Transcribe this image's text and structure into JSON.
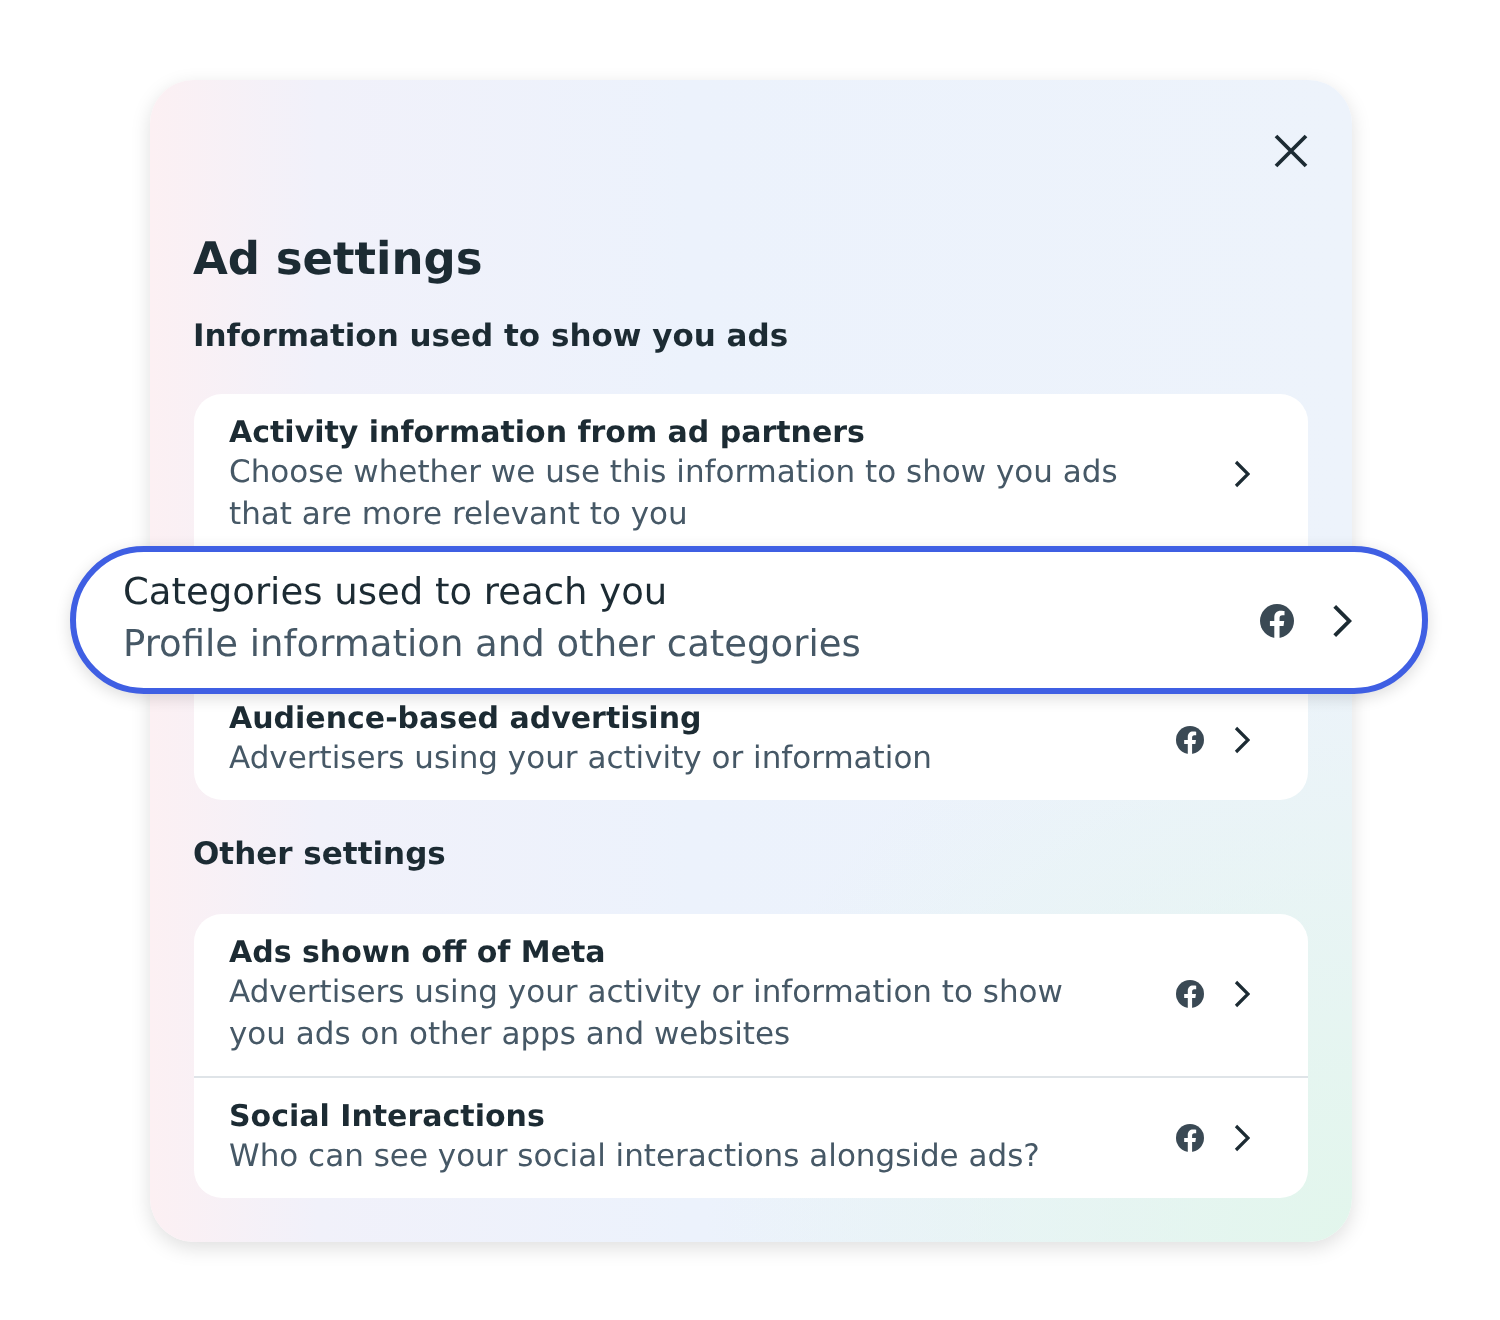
{
  "dialog": {
    "title": "Ad settings",
    "sections": [
      {
        "heading": "Information used to show you ads",
        "rows": [
          {
            "title": "Activity information from ad partners",
            "description": "Choose whether we use this information to show you ads that are more relevant to you",
            "has_logo": false,
            "highlighted": false
          },
          {
            "title": "Categories used to reach you",
            "description": "Profile information and other categories",
            "has_logo": true,
            "highlighted": true
          },
          {
            "title": "Audience-based advertising",
            "description": "Advertisers using your activity or information",
            "has_logo": true,
            "highlighted": false
          }
        ]
      },
      {
        "heading": "Other settings",
        "rows": [
          {
            "title": "Ads shown off of Meta",
            "description": "Advertisers using your activity or information to show you ads on other apps and websites",
            "has_logo": true,
            "highlighted": false
          },
          {
            "title": "Social Interactions",
            "description": "Who can see your social interactions alongside ads?",
            "has_logo": true,
            "highlighted": false
          }
        ]
      }
    ]
  }
}
